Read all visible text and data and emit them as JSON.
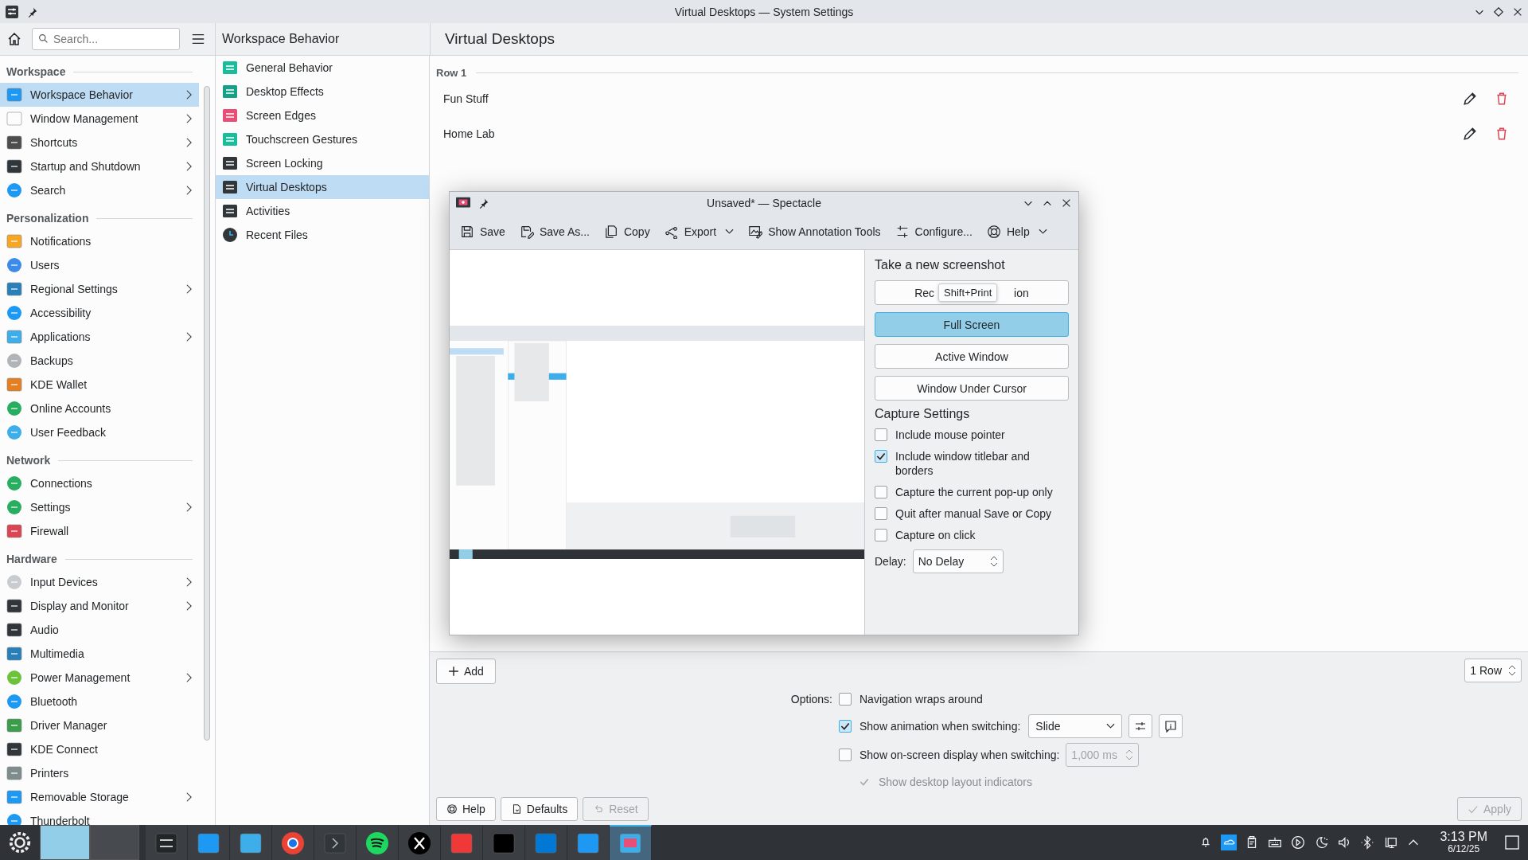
{
  "window": {
    "title": "Virtual Desktops — System Settings"
  },
  "search": {
    "placeholder": "Search..."
  },
  "header": {
    "category": "Workspace Behavior",
    "page": "Virtual Desktops"
  },
  "sidebar": {
    "groups": [
      {
        "title": "Workspace",
        "items": [
          {
            "label": "Workspace Behavior",
            "has_children": true,
            "selected": true
          },
          {
            "label": "Window Management",
            "has_children": true,
            "selected": false
          },
          {
            "label": "Shortcuts",
            "has_children": true,
            "selected": false
          },
          {
            "label": "Startup and Shutdown",
            "has_children": true,
            "selected": false
          },
          {
            "label": "Search",
            "has_children": true,
            "selected": false
          }
        ]
      },
      {
        "title": "Personalization",
        "items": [
          {
            "label": "Notifications",
            "has_children": false,
            "selected": false
          },
          {
            "label": "Users",
            "has_children": false,
            "selected": false
          },
          {
            "label": "Regional Settings",
            "has_children": true,
            "selected": false
          },
          {
            "label": "Accessibility",
            "has_children": false,
            "selected": false
          },
          {
            "label": "Applications",
            "has_children": true,
            "selected": false
          },
          {
            "label": "Backups",
            "has_children": false,
            "selected": false
          },
          {
            "label": "KDE Wallet",
            "has_children": false,
            "selected": false
          },
          {
            "label": "Online Accounts",
            "has_children": false,
            "selected": false
          },
          {
            "label": "User Feedback",
            "has_children": false,
            "selected": false
          }
        ]
      },
      {
        "title": "Network",
        "items": [
          {
            "label": "Connections",
            "has_children": false,
            "selected": false
          },
          {
            "label": "Settings",
            "has_children": true,
            "selected": false
          },
          {
            "label": "Firewall",
            "has_children": false,
            "selected": false
          }
        ]
      },
      {
        "title": "Hardware",
        "items": [
          {
            "label": "Input Devices",
            "has_children": true,
            "selected": false
          },
          {
            "label": "Display and Monitor",
            "has_children": true,
            "selected": false
          },
          {
            "label": "Audio",
            "has_children": false,
            "selected": false
          },
          {
            "label": "Multimedia",
            "has_children": false,
            "selected": false
          },
          {
            "label": "Power Management",
            "has_children": true,
            "selected": false
          },
          {
            "label": "Bluetooth",
            "has_children": false,
            "selected": false
          },
          {
            "label": "Driver Manager",
            "has_children": false,
            "selected": false
          },
          {
            "label": "KDE Connect",
            "has_children": false,
            "selected": false
          },
          {
            "label": "Printers",
            "has_children": false,
            "selected": false
          },
          {
            "label": "Removable Storage",
            "has_children": true,
            "selected": false
          },
          {
            "label": "Thunderbolt",
            "has_children": false,
            "selected": false
          }
        ]
      }
    ]
  },
  "subpages": [
    {
      "label": "General Behavior",
      "selected": false
    },
    {
      "label": "Desktop Effects",
      "selected": false
    },
    {
      "label": "Screen Edges",
      "selected": false
    },
    {
      "label": "Touchscreen Gestures",
      "selected": false
    },
    {
      "label": "Screen Locking",
      "selected": false
    },
    {
      "label": "Virtual Desktops",
      "selected": true
    },
    {
      "label": "Activities",
      "selected": false
    },
    {
      "label": "Recent Files",
      "selected": false
    }
  ],
  "rows": [
    {
      "title": "Row 1",
      "desktops": [
        {
          "name": "Fun Stuff"
        },
        {
          "name": "Home Lab"
        }
      ]
    }
  ],
  "add_button": "Add",
  "rows_spin": "1 Row",
  "options_label": "Options:",
  "options": [
    {
      "kind": "plain",
      "label": "Navigation wraps around",
      "checked": false,
      "disabled": false
    },
    {
      "kind": "animation",
      "label": "Show animation when switching:",
      "checked": true,
      "disabled": false,
      "combo": "Slide"
    },
    {
      "kind": "osd",
      "label": "Show on-screen display when switching:",
      "checked": false,
      "disabled": false,
      "spin": "1,000 ms",
      "spin_disabled": true
    },
    {
      "kind": "sub",
      "label": "Show desktop layout indicators",
      "checked": true,
      "disabled": true
    }
  ],
  "footer_buttons": [
    {
      "label": "Help",
      "disabled": false
    },
    {
      "label": "Defaults",
      "disabled": false
    },
    {
      "label": "Reset",
      "disabled": true
    },
    {
      "label": "Apply",
      "disabled": true
    }
  ],
  "spectacle": {
    "title": "Unsaved* — Spectacle",
    "toolbar": [
      {
        "label": "Save",
        "menu": false
      },
      {
        "label": "Save As...",
        "menu": false
      },
      {
        "label": "Copy",
        "menu": false
      },
      {
        "label": "Export",
        "menu": true
      },
      {
        "label": "Show Annotation Tools",
        "menu": false
      },
      {
        "label": "Configure...",
        "menu": false
      },
      {
        "label": "Help",
        "menu": true
      }
    ],
    "new_heading": "Take a new screenshot",
    "capture_buttons": [
      {
        "label_parts": [
          "Rec",
          "ion"
        ],
        "selected": false
      },
      {
        "label": "Full Screen",
        "selected": true
      },
      {
        "label": "Active Window",
        "selected": false
      },
      {
        "label": "Window Under Cursor",
        "selected": false
      }
    ],
    "tooltip": "Shift+Print",
    "settings_heading": "Capture Settings",
    "capture_options": [
      {
        "label": "Include mouse pointer",
        "checked": false
      },
      {
        "label": "Include window titlebar and borders",
        "checked": true
      },
      {
        "label": "Capture the current pop-up only",
        "checked": false
      },
      {
        "label": "Quit after manual Save or Copy",
        "checked": false
      },
      {
        "label": "Capture on click",
        "checked": false
      }
    ],
    "delay_label": "Delay:",
    "delay": "No Delay"
  },
  "taskbar": {
    "pager": [
      {
        "selected": true
      },
      {
        "selected": false
      }
    ],
    "tasks": [
      {
        "selected": false
      },
      {
        "selected": false
      },
      {
        "selected": false
      },
      {
        "selected": false
      },
      {
        "selected": false
      },
      {
        "selected": false
      },
      {
        "selected": false
      },
      {
        "selected": false
      },
      {
        "selected": false
      },
      {
        "selected": false
      },
      {
        "selected": false
      },
      {
        "selected": true
      }
    ],
    "time": "3:13 PM",
    "date": "6/12/25"
  }
}
